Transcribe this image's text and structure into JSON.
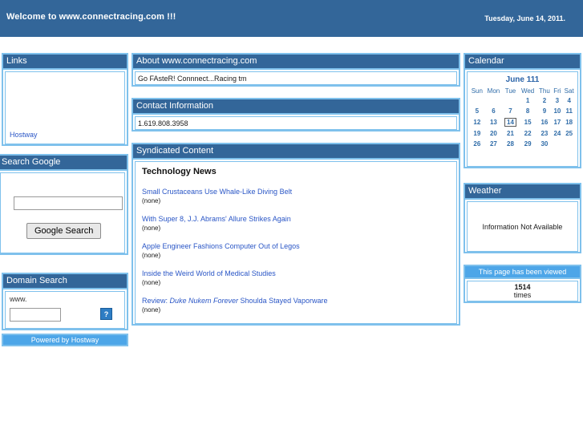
{
  "banner": {
    "title": "Welcome to www.connectracing.com !!!",
    "date": "Tuesday, June 14, 2011."
  },
  "links_panel": {
    "heading": "Links",
    "items": [
      {
        "label": "Hostway"
      }
    ]
  },
  "google_panel": {
    "heading": "Search Google",
    "input_value": "",
    "input_placeholder": "",
    "button_label": "Google Search"
  },
  "domain_panel": {
    "heading": "Domain Search",
    "prefix_label": "www.",
    "input_value": "",
    "input_placeholder": "",
    "go_icon": "broken-image-icon",
    "go_glyph": "?"
  },
  "powered_by": {
    "label": "Powered by Hostway"
  },
  "about_panel": {
    "heading": "About www.connectracing.com",
    "text": "Go FAsteR! Connnect...Racing tm"
  },
  "contact_panel": {
    "heading": "Contact Information",
    "text": "1.619.808.3958"
  },
  "syndicated_panel": {
    "heading": "Syndicated Content",
    "subtitle": "Technology News",
    "items": [
      {
        "title": "Small Crustaceans Use Whale-Like Diving Belt",
        "title_italic": "",
        "title_tail": "",
        "desc": "(none)"
      },
      {
        "title": "With Super 8, J.J. Abrams' Allure Strikes Again",
        "title_italic": "",
        "title_tail": "",
        "desc": "(none)"
      },
      {
        "title": "Apple Engineer Fashions Computer Out of Legos",
        "title_italic": "",
        "title_tail": "",
        "desc": "(none)"
      },
      {
        "title": "Inside the Weird World of Medical Studies",
        "title_italic": "",
        "title_tail": "",
        "desc": "(none)"
      },
      {
        "title": "Review: ",
        "title_italic": "Duke Nukem Forever",
        "title_tail": " Shoulda Stayed Vaporware",
        "desc": "(none)"
      }
    ]
  },
  "calendar_panel": {
    "heading": "Calendar",
    "title": "June 111",
    "weekdays": [
      "Sun",
      "Mon",
      "Tue",
      "Wed",
      "Thu",
      "Fri",
      "Sat"
    ],
    "weeks": [
      [
        "",
        "",
        "",
        "1",
        "2",
        "3",
        "4"
      ],
      [
        "5",
        "6",
        "7",
        "8",
        "9",
        "10",
        "11"
      ],
      [
        "12",
        "13",
        "14",
        "15",
        "16",
        "17",
        "18"
      ],
      [
        "19",
        "20",
        "21",
        "22",
        "23",
        "24",
        "25"
      ],
      [
        "26",
        "27",
        "28",
        "29",
        "30",
        "",
        ""
      ]
    ],
    "today": "14"
  },
  "weather_panel": {
    "heading": "Weather",
    "text": "Information Not Available"
  },
  "counter_panel": {
    "heading": "This page has been viewed",
    "count": "1514",
    "label": "times"
  },
  "colors": {
    "banner_blue": "#336699",
    "panel_head_blue": "#336699",
    "panel_border_blue": "#7fc1ec",
    "light_blue": "#4da6e8",
    "link_blue": "#2a56c6"
  }
}
